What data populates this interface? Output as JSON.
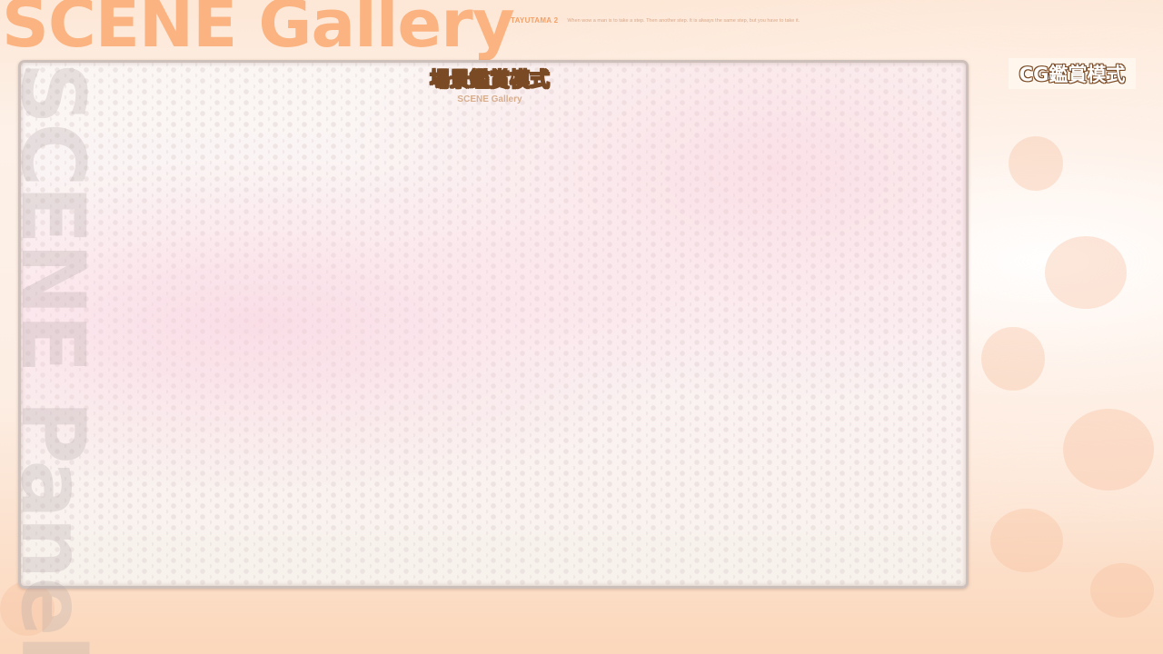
{
  "header": {
    "title": "SCENE Gallery",
    "brand": "TAYUTAMA 2",
    "tagline": "When wow a man is to take a step. Then another step. It is always the same step, but you have to take it."
  },
  "panel": {
    "vertical_title": "SCENE Panel",
    "heading_cn": "場景鑑賞模式",
    "heading_en": "SCENE Gallery"
  },
  "nav": {
    "cg_button_label": "CG鑑賞模式"
  },
  "colors": {
    "title_orange": "#fbb07a",
    "heading_brown": "#7a4a25",
    "panel_border": "#cdbfba"
  }
}
